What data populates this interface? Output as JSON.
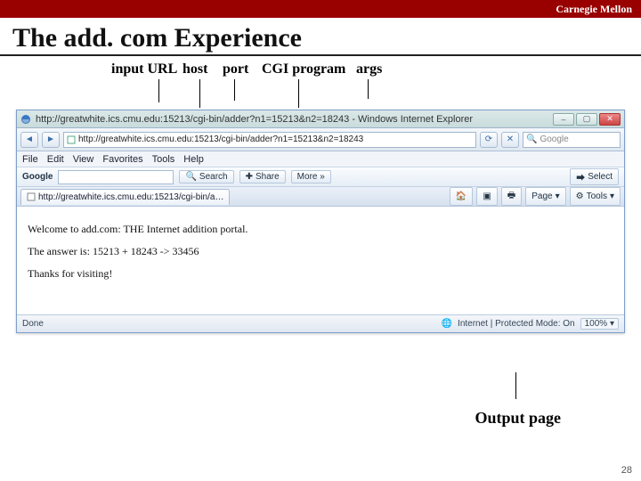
{
  "brand": {
    "institution": "Carnegie Mellon"
  },
  "slide": {
    "title": "The add. com Experience",
    "page_number": "28",
    "output_label": "Output page"
  },
  "url_labels": {
    "input_url": "input URL",
    "host": "host",
    "port": "port",
    "cgi_program": "CGI program",
    "args": "args"
  },
  "browser": {
    "window_title": "http://greatwhite.ics.cmu.edu:15213/cgi-bin/adder?n1=15213&n2=18243 - Windows Internet Explorer",
    "address_url": "http://greatwhite.ics.cmu.edu:15213/cgi-bin/adder?n1=15213&n2=18243",
    "search_engine_label": "Google",
    "menu": {
      "file": "File",
      "edit": "Edit",
      "view": "View",
      "favorites": "Favorites",
      "tools": "Tools",
      "help": "Help"
    },
    "google_toolbar": {
      "brand": "Google",
      "search": "Search",
      "share": "Share",
      "more": "More »",
      "select": "Select"
    },
    "tab_title": "http://greatwhite.ics.cmu.edu:15213/cgi-bin/a…",
    "tab_tools": {
      "home": " ",
      "page": "Page",
      "tools": "Tools"
    },
    "page": {
      "line1": "Welcome to add.com: THE Internet addition portal.",
      "line2": "The answer is: 15213 + 18243 -> 33456",
      "line3": "Thanks for visiting!"
    },
    "status": {
      "left": "Done",
      "zone": "Internet | Protected Mode: On",
      "zoom": "100%"
    }
  }
}
